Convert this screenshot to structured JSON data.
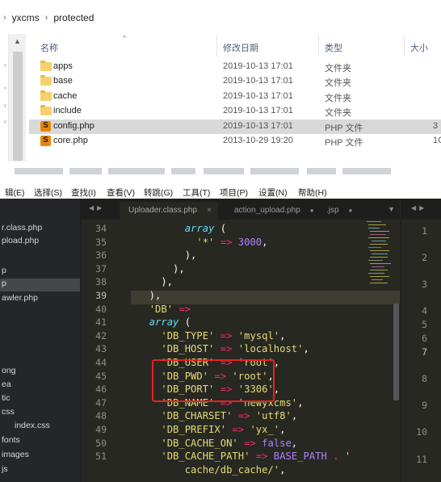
{
  "explorer": {
    "breadcrumb": [
      "yxcms",
      "protected"
    ],
    "columns": {
      "name": "名称",
      "date": "修改日期",
      "type": "类型",
      "size": "大小"
    },
    "files": [
      {
        "name": "apps",
        "date": "2019-10-13 17:01",
        "type": "文件夹",
        "size": "",
        "icon": "folder-icon"
      },
      {
        "name": "base",
        "date": "2019-10-13 17:01",
        "type": "文件夹",
        "size": "",
        "icon": "folder-icon"
      },
      {
        "name": "cache",
        "date": "2019-10-13 17:01",
        "type": "文件夹",
        "size": "",
        "icon": "folder-icon"
      },
      {
        "name": "include",
        "date": "2019-10-13 17:01",
        "type": "文件夹",
        "size": "",
        "icon": "folder-icon"
      },
      {
        "name": "config.php",
        "date": "2019-10-13 17:01",
        "type": "PHP 文件",
        "size": "3",
        "icon": "sublime-php-icon",
        "selected": true
      },
      {
        "name": "core.php",
        "date": "2013-10-29 19:20",
        "type": "PHP 文件",
        "size": "1C",
        "icon": "sublime-php-icon"
      }
    ]
  },
  "editor": {
    "menu": [
      "辑(E)",
      "选择(S)",
      "查找(I)",
      "查看(V)",
      "转跳(G)",
      "工具(T)",
      "项目(P)",
      "设置(N)",
      "帮助(H)"
    ],
    "sidebar": [
      {
        "label": "r.class.php"
      },
      {
        "label": "pload.php"
      },
      {
        "label": "p"
      },
      {
        "label": "p",
        "selected": true
      },
      {
        "label": "awler.php"
      },
      {
        "label": "ong"
      },
      {
        "label": "ea"
      },
      {
        "label": "tic"
      },
      {
        "label": "css"
      },
      {
        "label": "index.css"
      },
      {
        "label": "fonts"
      },
      {
        "label": "images"
      },
      {
        "label": "js"
      }
    ],
    "tabs": [
      {
        "label": "Uploader.class.php",
        "marker": "×",
        "active": true
      },
      {
        "label": "action_upload.php",
        "marker": "●"
      },
      {
        "label": ".jsp",
        "marker": "●"
      }
    ],
    "line_numbers": [
      "34",
      "35",
      "36",
      "37",
      "38",
      "39",
      "40",
      "41",
      "42",
      "43",
      "44",
      "45",
      "46",
      "47",
      "48",
      "49",
      "50",
      "51",
      ""
    ],
    "current_line": "39",
    "code_lines": [
      [
        {
          "t": "        ",
          "c": "pl"
        },
        {
          "t": "array",
          "c": "kw"
        },
        {
          "t": " (",
          "c": "pl"
        }
      ],
      [
        {
          "t": "          ",
          "c": "pl"
        },
        {
          "t": "'*'",
          "c": "st"
        },
        {
          "t": " => ",
          "c": "op"
        },
        {
          "t": "3000",
          "c": "nm"
        },
        {
          "t": ",",
          "c": "pl"
        }
      ],
      [
        {
          "t": "        ),",
          "c": "pl"
        }
      ],
      [
        {
          "t": "      ),",
          "c": "pl"
        }
      ],
      [
        {
          "t": "    ),",
          "c": "pl"
        }
      ],
      [
        {
          "t": "  ),",
          "c": "pl"
        }
      ],
      [
        {
          "t": "  ",
          "c": "pl"
        },
        {
          "t": "'DB'",
          "c": "st"
        },
        {
          "t": " =>",
          "c": "op"
        }
      ],
      [
        {
          "t": "  ",
          "c": "pl"
        },
        {
          "t": "array",
          "c": "kw"
        },
        {
          "t": " (",
          "c": "pl"
        }
      ],
      [
        {
          "t": "    ",
          "c": "pl"
        },
        {
          "t": "'DB_TYPE'",
          "c": "st"
        },
        {
          "t": " => ",
          "c": "op"
        },
        {
          "t": "'mysql'",
          "c": "st"
        },
        {
          "t": ",",
          "c": "pl"
        }
      ],
      [
        {
          "t": "    ",
          "c": "pl"
        },
        {
          "t": "'DB_HOST'",
          "c": "st"
        },
        {
          "t": " => ",
          "c": "op"
        },
        {
          "t": "'localhost'",
          "c": "st"
        },
        {
          "t": ",",
          "c": "pl"
        }
      ],
      [
        {
          "t": "    ",
          "c": "pl"
        },
        {
          "t": "'DB_USER'",
          "c": "st"
        },
        {
          "t": " => ",
          "c": "op"
        },
        {
          "t": "'root'",
          "c": "st"
        },
        {
          "t": ",",
          "c": "pl"
        }
      ],
      [
        {
          "t": "    ",
          "c": "pl"
        },
        {
          "t": "'DB_PWD'",
          "c": "st"
        },
        {
          "t": " => ",
          "c": "op"
        },
        {
          "t": "'root'",
          "c": "st"
        },
        {
          "t": ",",
          "c": "pl"
        }
      ],
      [
        {
          "t": "    ",
          "c": "pl"
        },
        {
          "t": "'DB_PORT'",
          "c": "st"
        },
        {
          "t": " => ",
          "c": "op"
        },
        {
          "t": "'3306'",
          "c": "st"
        },
        {
          "t": ",",
          "c": "pl"
        }
      ],
      [
        {
          "t": "    ",
          "c": "pl"
        },
        {
          "t": "'DB_NAME'",
          "c": "st"
        },
        {
          "t": " => ",
          "c": "op"
        },
        {
          "t": "'newyxcms'",
          "c": "st"
        },
        {
          "t": ",",
          "c": "pl"
        }
      ],
      [
        {
          "t": "    ",
          "c": "pl"
        },
        {
          "t": "'DB_CHARSET'",
          "c": "st"
        },
        {
          "t": " => ",
          "c": "op"
        },
        {
          "t": "'utf8'",
          "c": "st"
        },
        {
          "t": ",",
          "c": "pl"
        }
      ],
      [
        {
          "t": "    ",
          "c": "pl"
        },
        {
          "t": "'DB_PREFIX'",
          "c": "st"
        },
        {
          "t": " => ",
          "c": "op"
        },
        {
          "t": "'yx_'",
          "c": "st"
        },
        {
          "t": ",",
          "c": "pl"
        }
      ],
      [
        {
          "t": "    ",
          "c": "pl"
        },
        {
          "t": "'DB_CACHE_ON'",
          "c": "st"
        },
        {
          "t": " => ",
          "c": "op"
        },
        {
          "t": "false",
          "c": "nm"
        },
        {
          "t": ",",
          "c": "pl"
        }
      ],
      [
        {
          "t": "    ",
          "c": "pl"
        },
        {
          "t": "'DB_CACHE_PATH'",
          "c": "st"
        },
        {
          "t": " => ",
          "c": "op"
        },
        {
          "t": "BASE_PATH",
          "c": "nm"
        },
        {
          "t": " . ",
          "c": "op"
        },
        {
          "t": "'",
          "c": "st"
        }
      ],
      [
        {
          "t": "        ",
          "c": "pl"
        },
        {
          "t": "cache/db_cache/'",
          "c": "st"
        },
        {
          "t": ",",
          "c": "pl"
        }
      ]
    ],
    "pane2_line_numbers": [
      "1",
      "2",
      "3",
      "4",
      "5",
      "6",
      "7",
      "8",
      "9",
      "10",
      "11"
    ],
    "pane2_current_line": "7"
  },
  "colors": {
    "editor_bg": "#272822",
    "keyword": "#66d9ef",
    "string": "#e6db74",
    "operator": "#f92672",
    "number": "#ae81ff",
    "annotation_box": "#e8221f"
  }
}
